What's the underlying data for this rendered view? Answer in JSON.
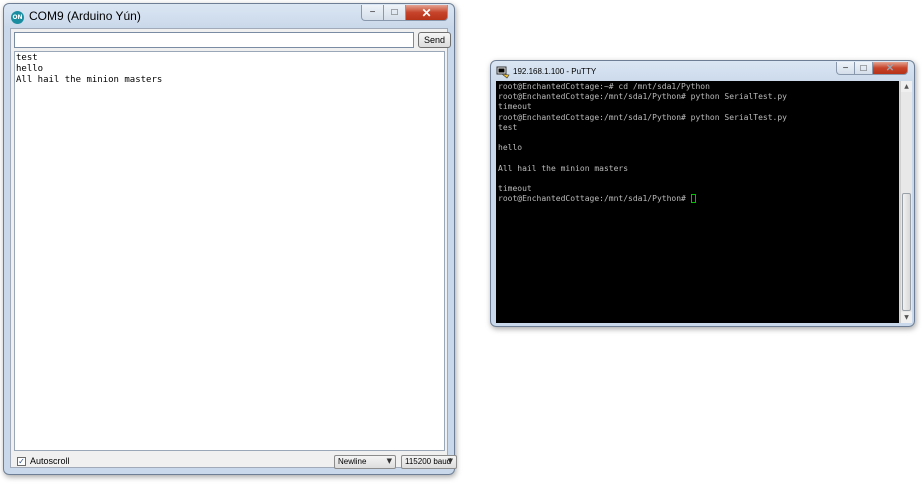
{
  "arduino": {
    "title": "COM9 (Arduino Yún)",
    "icon_label": "ON",
    "send_input_value": "",
    "send_label": "Send",
    "output_lines": [
      "test",
      "hello",
      "All hail the minion masters"
    ],
    "autoscroll_label": "Autoscroll",
    "autoscroll_checked": true,
    "line_ending": "Newline",
    "baud_rate": "115200 baud"
  },
  "putty": {
    "title": "192.168.1.100 - PuTTY",
    "terminal_lines": [
      "root@EnchantedCottage:~# cd /mnt/sda1/Python",
      "root@EnchantedCottage:/mnt/sda1/Python# python SerialTest.py",
      "timeout",
      "root@EnchantedCottage:/mnt/sda1/Python# python SerialTest.py",
      "test",
      "",
      "hello",
      "",
      "All hail the minion masters",
      "",
      "timeout"
    ],
    "prompt_line": "root@EnchantedCottage:/mnt/sda1/Python# "
  },
  "icons": {
    "checkmark": "✓",
    "dropdown": "▼",
    "minimize": "−",
    "maximize": "□",
    "close": "✕",
    "scroll_up": "▲",
    "scroll_down": "▼"
  },
  "colors": {
    "terminal_bg": "#000000",
    "terminal_fg": "#bbbbbb",
    "cursor": "#00c000",
    "close_button": "#c7432a"
  }
}
